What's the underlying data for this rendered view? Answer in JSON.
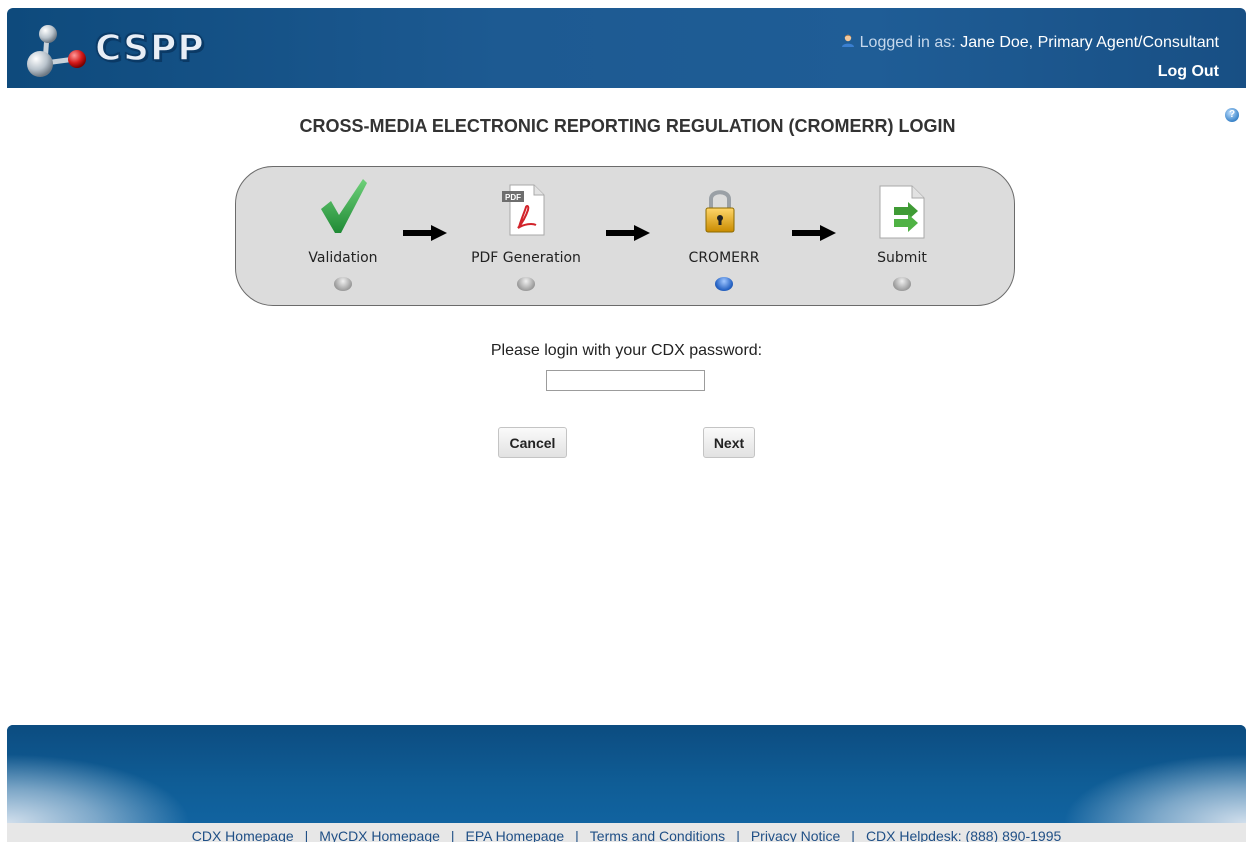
{
  "header": {
    "logo_text": "CSPP",
    "logged_in_prefix": "Logged in as:",
    "user_name": "Jane Doe, Primary Agent/Consultant",
    "logout_label": "Log Out"
  },
  "page": {
    "title": "CROSS-MEDIA ELECTRONIC REPORTING REGULATION (CROMERR) LOGIN",
    "help_icon": "?"
  },
  "steps": {
    "current": "CROMERR",
    "items": [
      {
        "label": "Validation",
        "icon": "checkmark-icon",
        "active": false
      },
      {
        "label": "PDF Generation",
        "icon": "pdf-document-icon",
        "active": false
      },
      {
        "label": "CROMERR",
        "icon": "padlock-icon",
        "active": true
      },
      {
        "label": "Submit",
        "icon": "submit-document-icon",
        "active": false
      }
    ]
  },
  "login": {
    "prompt": "Please login with your CDX password:",
    "password_value": "",
    "cancel_label": "Cancel",
    "next_label": "Next"
  },
  "footer": {
    "links": [
      "CDX Homepage",
      "MyCDX Homepage",
      "EPA Homepage",
      "Terms and Conditions",
      "Privacy Notice",
      "CDX Helpdesk: (888) 890-1995"
    ]
  }
}
